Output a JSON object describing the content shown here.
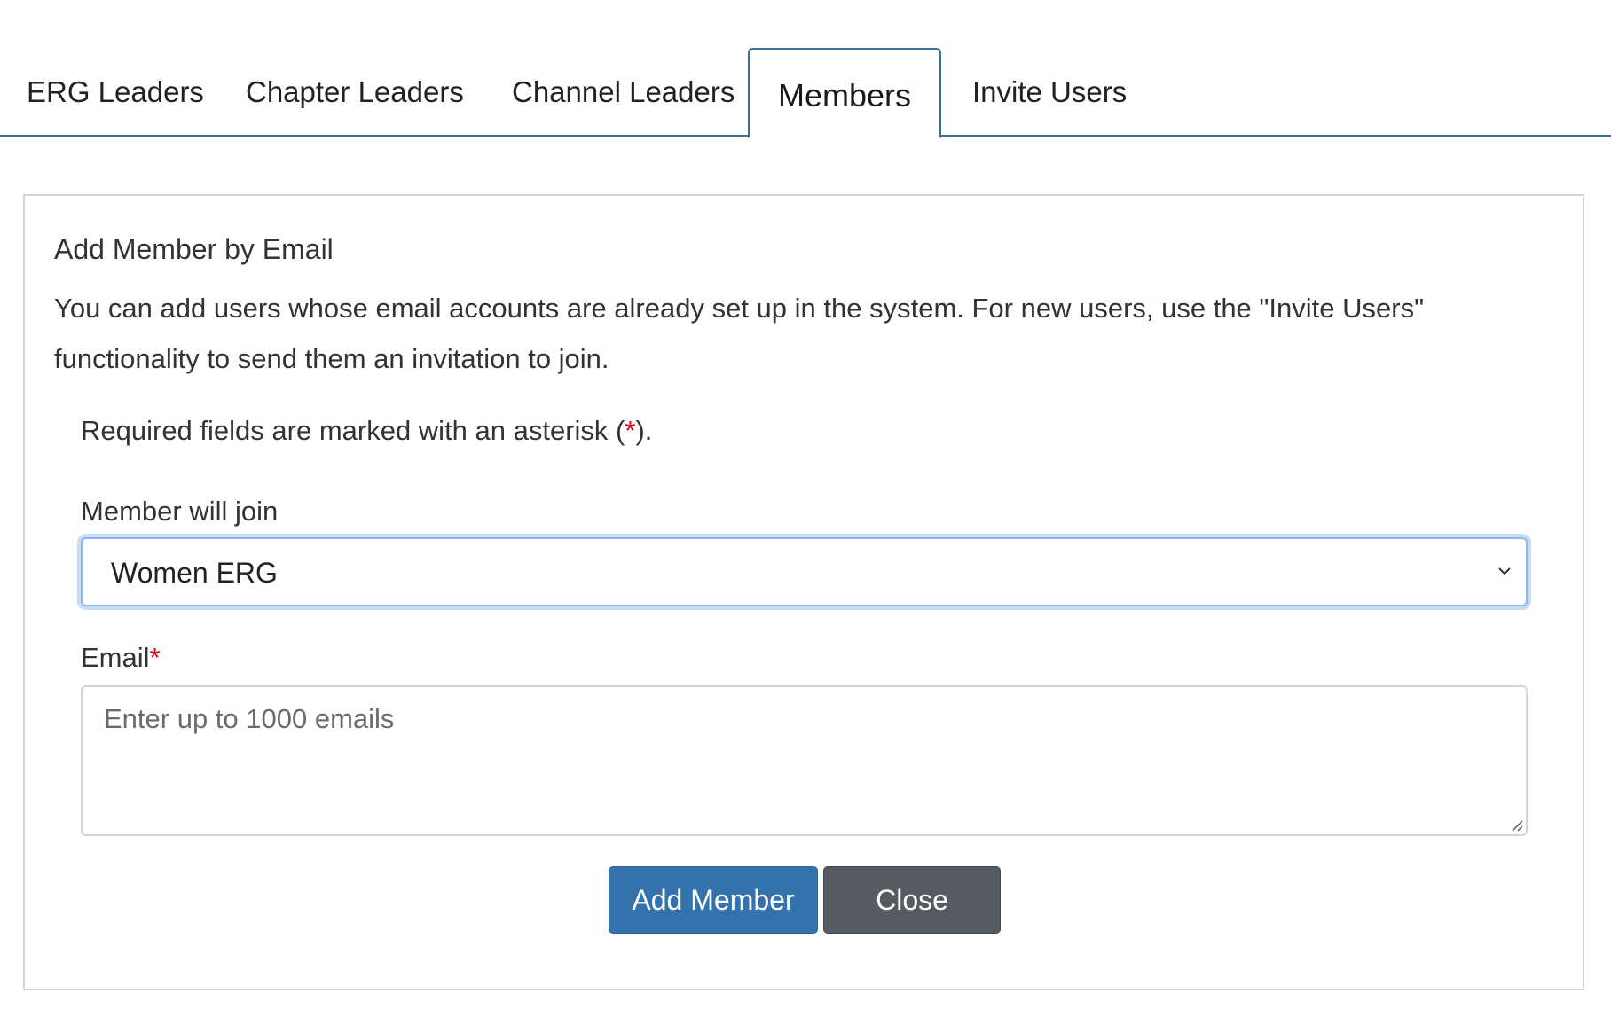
{
  "tabs": [
    {
      "label": "ERG Leaders",
      "active": false
    },
    {
      "label": "Chapter Leaders",
      "active": false
    },
    {
      "label": "Channel Leaders",
      "active": false
    },
    {
      "label": "Members",
      "active": true
    },
    {
      "label": "Invite Users",
      "active": false
    }
  ],
  "panel": {
    "title": "Add Member by Email",
    "description": "You can add users whose email accounts are already set up in the system. For new users, use the \"Invite Users\" functionality to send them an invitation to join.",
    "required_note_prefix": "Required fields are marked with an asterisk (",
    "required_note_asterisk": "*",
    "required_note_suffix": ")."
  },
  "form": {
    "join_label": "Member will join",
    "join_value": "Women ERG",
    "email_label": "Email",
    "email_required_mark": "*",
    "email_placeholder": "Enter up to 1000 emails",
    "email_value": ""
  },
  "buttons": {
    "add_label": "Add Member",
    "close_label": "Close"
  },
  "colors": {
    "tab_border": "#3a6f98",
    "primary_button": "#3372ad",
    "secondary_button": "#565b62",
    "required_mark": "#d0021b",
    "focus_ring": "#c9dcf7"
  },
  "icons": {
    "select_chevron": "chevron-down-icon",
    "textarea_resize": "resize-handle-icon"
  }
}
